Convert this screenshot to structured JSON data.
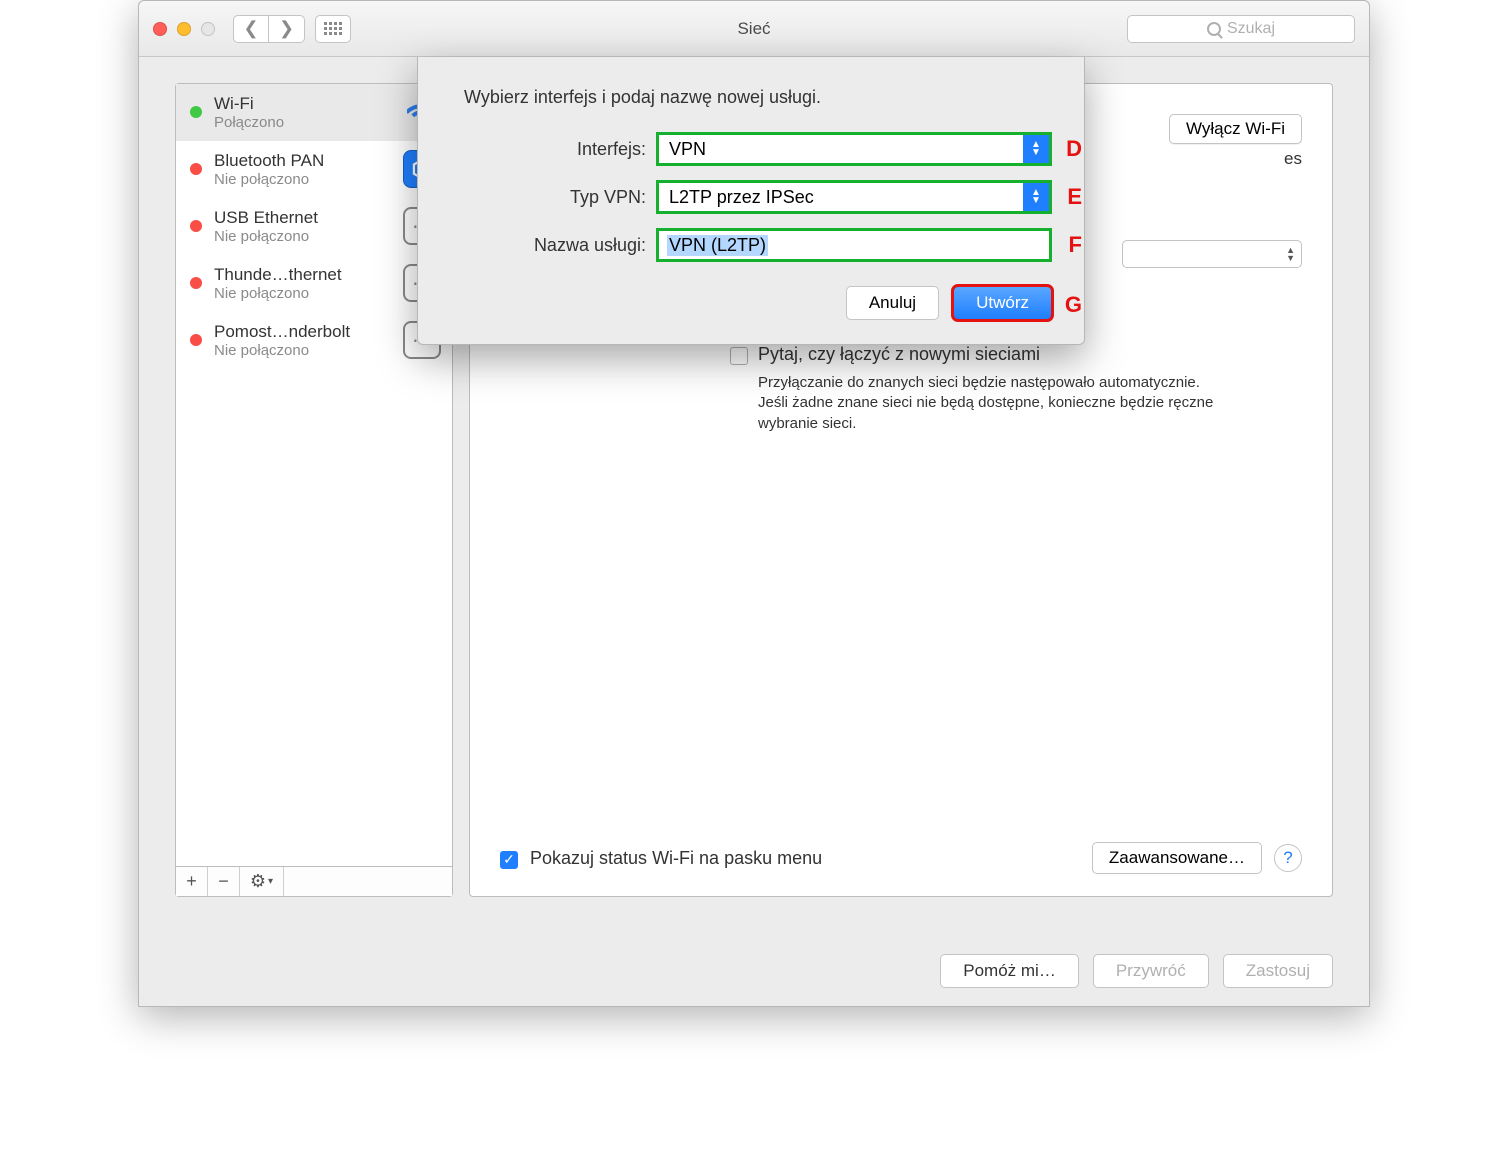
{
  "window": {
    "title": "Sieć"
  },
  "search": {
    "placeholder": "Szukaj"
  },
  "sidebar": {
    "services": [
      {
        "name": "Wi-Fi",
        "status": "Połączono",
        "dot": "green",
        "icon": "wifi",
        "selected": true
      },
      {
        "name": "Bluetooth PAN",
        "status": "Nie połączono",
        "dot": "red",
        "icon": "bt",
        "selected": false
      },
      {
        "name": "USB Ethernet",
        "status": "Nie połączono",
        "dot": "red",
        "icon": "eth",
        "selected": false
      },
      {
        "name": "Thunde…thernet",
        "status": "Nie połączono",
        "dot": "red",
        "icon": "eth",
        "selected": false
      },
      {
        "name": "Pomost…nderbolt",
        "status": "Nie połączono",
        "dot": "red",
        "icon": "eth",
        "selected": false
      }
    ]
  },
  "main": {
    "wifi_off_label": "Wyłącz Wi-Fi",
    "status_partial": "es",
    "ask_label": "Pytaj, czy łączyć z nowymi sieciami",
    "ask_desc": "Przyłączanie do znanych sieci będzie następowało automatycznie. Jeśli żadne znane sieci nie będą dostępne, konieczne będzie ręczne wybranie sieci.",
    "show_status_label": "Pokazuj status Wi-Fi na pasku menu",
    "advanced_label": "Zaawansowane…"
  },
  "footer": {
    "help": "Pomóż mi…",
    "revert": "Przywróć",
    "apply": "Zastosuj"
  },
  "sheet": {
    "title": "Wybierz interfejs i podaj nazwę nowej usługi.",
    "rows": [
      {
        "label": "Interfejs:",
        "value": "VPN",
        "type": "select",
        "annot": "D"
      },
      {
        "label": "Typ VPN:",
        "value": "L2TP przez IPSec",
        "type": "select",
        "annot": "E"
      },
      {
        "label": "Nazwa usługi:",
        "value": "VPN (L2TP)",
        "type": "text",
        "annot": "F"
      }
    ],
    "cancel": "Anuluj",
    "create": "Utwórz",
    "create_annot": "G"
  }
}
